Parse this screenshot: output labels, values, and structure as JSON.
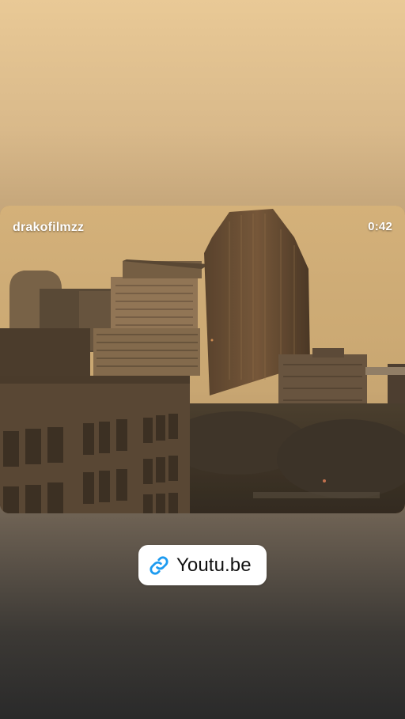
{
  "story": {
    "video": {
      "channel_name": "drakofilmzz",
      "duration": "0:42"
    },
    "link_sticker": {
      "label": "Youtu.be",
      "icon": "link-icon",
      "accent_color": "#1d9bf0"
    }
  }
}
